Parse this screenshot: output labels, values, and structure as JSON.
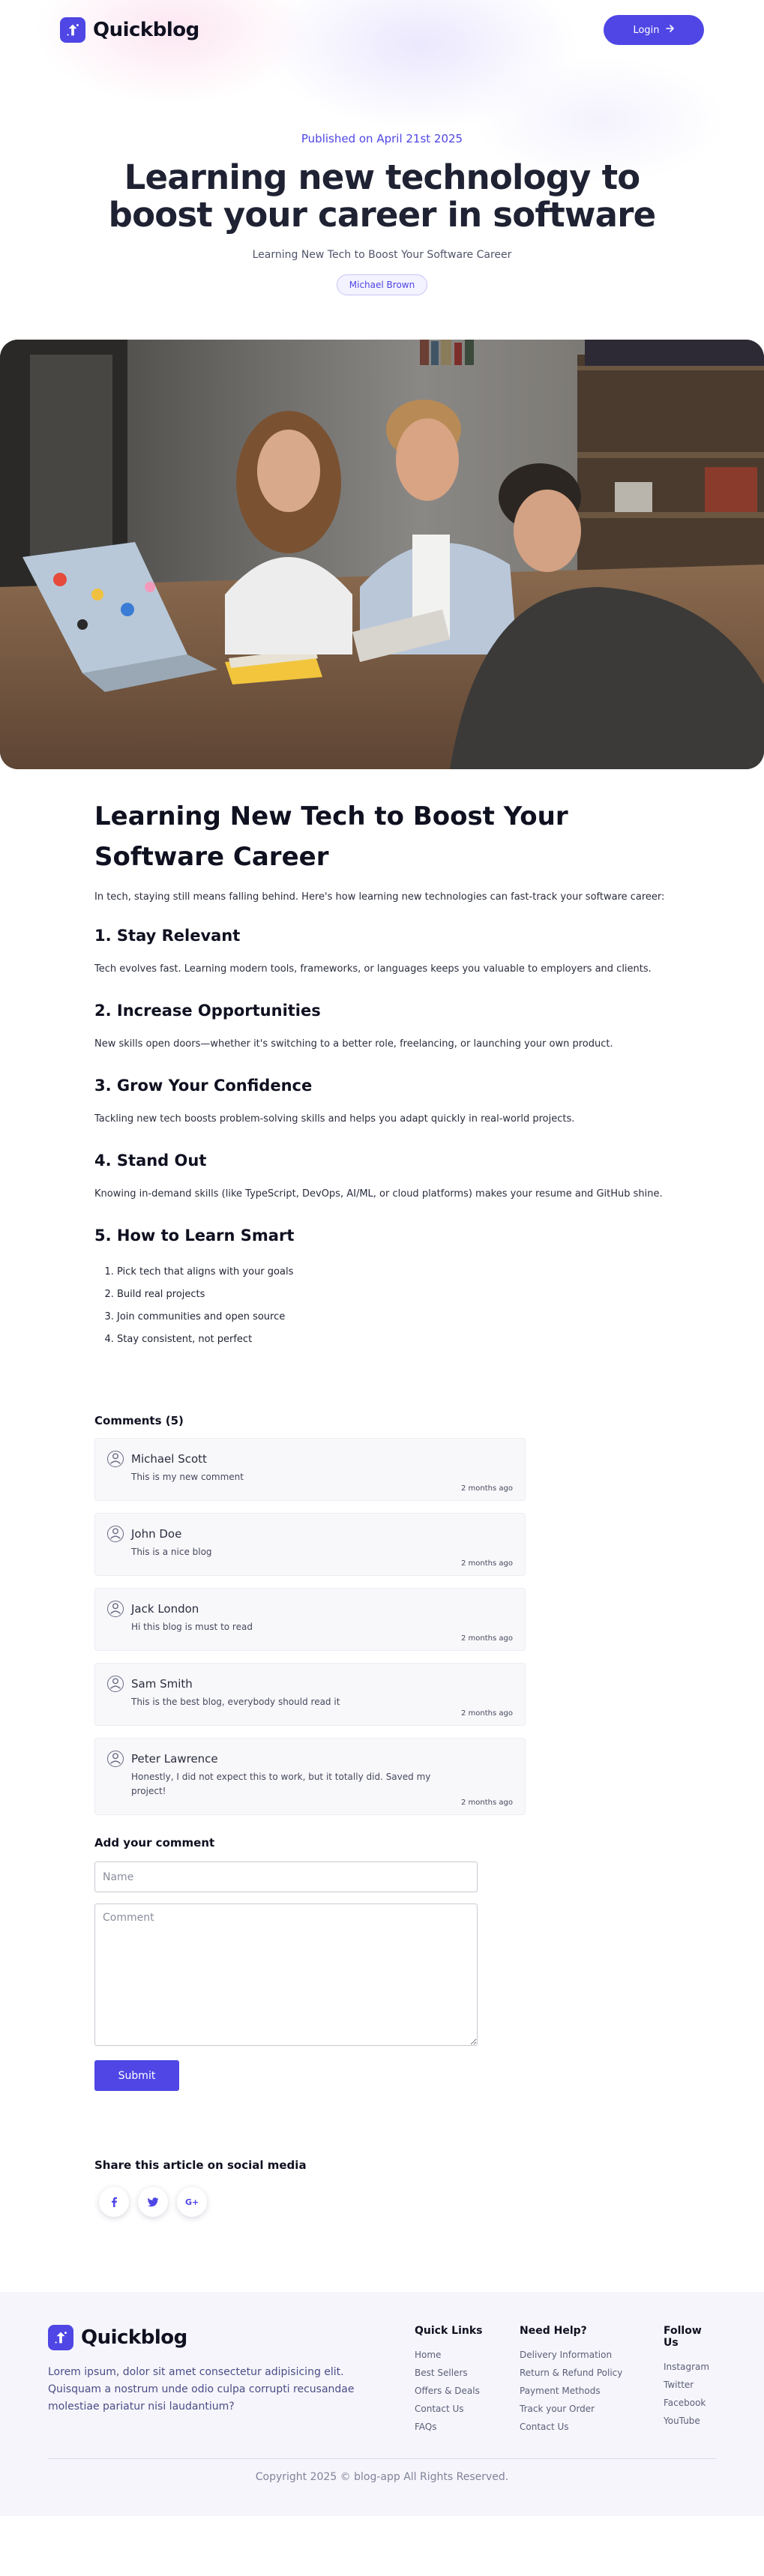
{
  "brand": {
    "name": "Quickblog",
    "icon": "quickblog-logo-icon",
    "accent_color": "#4f46e5"
  },
  "nav": {
    "login_label": "Login",
    "login_icon": "arrow-right-icon"
  },
  "hero": {
    "date": "Published on April 21st 2025",
    "title": "Learning new technology to boost your career in software",
    "subtitle": "Learning New Tech to Boost Your Software Career",
    "author": "Michael Brown"
  },
  "photo": {
    "alt": "people-at-table-photo"
  },
  "article": {
    "title": "Learning New Tech to Boost Your Software Career",
    "intro": "In tech, staying still means falling behind. Here's how learning new technologies can fast-track your software career:",
    "sections": [
      {
        "heading": "1. Stay Relevant",
        "body": "Tech evolves fast. Learning modern tools, frameworks, or languages keeps you valuable to employers and clients."
      },
      {
        "heading": "2. Increase Opportunities",
        "body": "New skills open doors—whether it's switching to a better role, freelancing, or launching your own product."
      },
      {
        "heading": "3. Grow Your Confidence",
        "body": "Tackling new tech boosts problem-solving skills and helps you adapt quickly in real-world projects."
      },
      {
        "heading": "4. Stand Out",
        "body": "Knowing in-demand skills (like TypeScript, DevOps, AI/ML, or cloud platforms) makes your resume and GitHub shine."
      }
    ],
    "how_to": {
      "heading": "5. How to Learn Smart",
      "steps": [
        "Pick tech that aligns with your goals",
        "Build real projects",
        "Join communities and open source",
        "Stay consistent, not perfect"
      ]
    }
  },
  "comments": {
    "heading": "Comments (5)",
    "items": [
      {
        "name": "Michael Scott",
        "text": "This is my new comment",
        "time": "2 months ago"
      },
      {
        "name": "John Doe",
        "text": "This is a nice blog",
        "time": "2 months ago"
      },
      {
        "name": "Jack London",
        "text": "Hi this blog is must to read",
        "time": "2 months ago"
      },
      {
        "name": "Sam Smith",
        "text": "This is the best blog, everybody should read it",
        "time": "2 months ago"
      },
      {
        "name": "Peter Lawrence",
        "text": "Honestly, I did not expect this to work, but it totally did. Saved my project!",
        "time": "2 months ago"
      }
    ]
  },
  "add_comment": {
    "heading": "Add your comment",
    "name_placeholder": "Name",
    "comment_placeholder": "Comment",
    "submit_label": "Submit"
  },
  "share": {
    "heading": "Share this article on social media",
    "buttons": [
      {
        "icon": "facebook-icon",
        "glyph": "f"
      },
      {
        "icon": "twitter-icon",
        "glyph": "🐦"
      },
      {
        "icon": "google-plus-icon",
        "glyph": "G+"
      }
    ]
  },
  "footer": {
    "brand_name": "Quickblog",
    "blurb": "Lorem ipsum, dolor sit amet consectetur adipisicing elit. Quisquam a nostrum unde odio culpa corrupti recusandae molestiae pariatur nisi laudantium?",
    "columns": [
      {
        "title": "Quick Links",
        "links": [
          "Home",
          "Best Sellers",
          "Offers & Deals",
          "Contact Us",
          "FAQs"
        ]
      },
      {
        "title": "Need Help?",
        "links": [
          "Delivery Information",
          "Return & Refund Policy",
          "Payment Methods",
          "Track your Order",
          "Contact Us"
        ]
      },
      {
        "title": "Follow Us",
        "links": [
          "Instagram",
          "Twitter",
          "Facebook",
          "YouTube"
        ]
      }
    ],
    "copyright": "Copyright 2025 © blog-app All Rights Reserved."
  }
}
